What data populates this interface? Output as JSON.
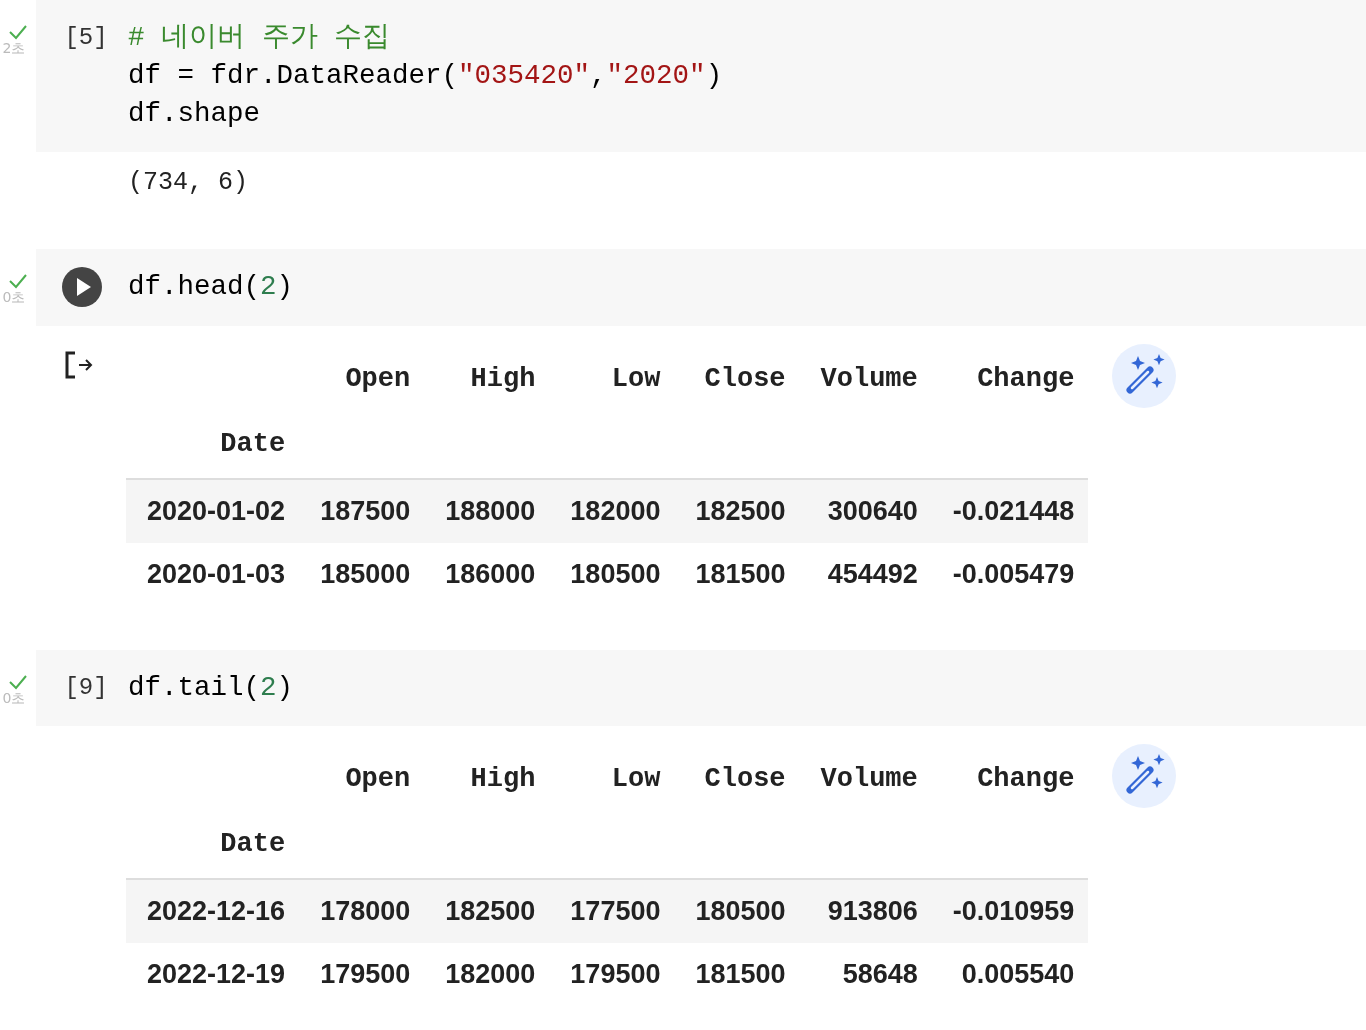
{
  "cells": [
    {
      "succeeded": true,
      "time": "2초",
      "prompt": {
        "kind": "count",
        "text": "[5]"
      },
      "code_lines": [
        [
          {
            "kind": "comment",
            "text": "# 네이버 주가 수집"
          }
        ],
        [
          {
            "kind": "plain",
            "text": "df = fdr.DataReader("
          },
          {
            "kind": "string",
            "text": "\"035420\""
          },
          {
            "kind": "plain",
            "text": ","
          },
          {
            "kind": "string",
            "text": "\"2020\""
          },
          {
            "kind": "plain",
            "text": ")"
          }
        ],
        [
          {
            "kind": "plain",
            "text": "df.shape"
          }
        ]
      ],
      "output": {
        "kind": "text",
        "text": "(734, 6)"
      }
    },
    {
      "succeeded": true,
      "time": "0초",
      "prompt": {
        "kind": "run_button"
      },
      "code_lines": [
        [
          {
            "kind": "plain",
            "text": "df.head("
          },
          {
            "kind": "number",
            "text": "2"
          },
          {
            "kind": "plain",
            "text": ")"
          }
        ]
      ],
      "output": {
        "kind": "table",
        "output_icon": true,
        "columns": [
          "Open",
          "High",
          "Low",
          "Close",
          "Volume",
          "Change"
        ],
        "index_name": "Date",
        "rows": [
          {
            "index": "2020-01-02",
            "values": [
              "187500",
              "188000",
              "182000",
              "182500",
              "300640",
              "-0.021448"
            ]
          },
          {
            "index": "2020-01-03",
            "values": [
              "185000",
              "186000",
              "180500",
              "181500",
              "454492",
              "-0.005479"
            ]
          }
        ]
      }
    },
    {
      "succeeded": true,
      "time": "0초",
      "prompt": {
        "kind": "count",
        "text": "[9]"
      },
      "code_lines": [
        [
          {
            "kind": "plain",
            "text": "df.tail("
          },
          {
            "kind": "number",
            "text": "2"
          },
          {
            "kind": "plain",
            "text": ")"
          }
        ]
      ],
      "output": {
        "kind": "table",
        "output_icon": false,
        "columns": [
          "Open",
          "High",
          "Low",
          "Close",
          "Volume",
          "Change"
        ],
        "index_name": "Date",
        "rows": [
          {
            "index": "2022-12-16",
            "values": [
              "178000",
              "182500",
              "177500",
              "180500",
              "913806",
              "-0.010959"
            ]
          },
          {
            "index": "2022-12-19",
            "values": [
              "179500",
              "182000",
              "179500",
              "181500",
              "58648",
              "0.005540"
            ]
          }
        ]
      }
    }
  ]
}
